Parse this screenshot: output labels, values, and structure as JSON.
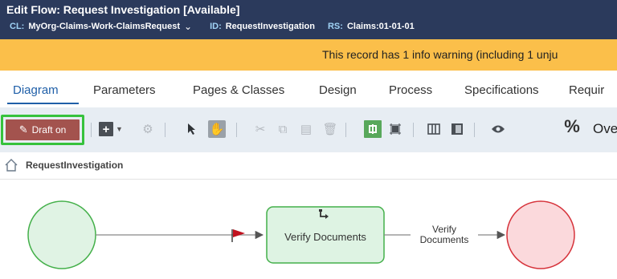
{
  "header": {
    "title": "Edit  Flow: Request Investigation [Available]",
    "cl_label": "CL:",
    "cl_value": "MyOrg-Claims-Work-ClaimsRequest",
    "id_label": "ID:",
    "id_value": "RequestInvestigation",
    "rs_label": "RS:",
    "rs_value": "Claims:01-01-01"
  },
  "warning": {
    "text": "This record has 1 info warning (including 1 unju"
  },
  "tabs": [
    {
      "label": "Diagram"
    },
    {
      "label": "Parameters"
    },
    {
      "label": "Pages & Classes"
    },
    {
      "label": "Design"
    },
    {
      "label": "Process"
    },
    {
      "label": "Specifications"
    },
    {
      "label": "Requir"
    }
  ],
  "toolbar": {
    "draft_label": "Draft on",
    "overflow_label": "Ove",
    "percent_label": "%"
  },
  "breadcrumb": {
    "label": "RequestInvestigation"
  },
  "diagram": {
    "assignment_label": "Verify Documents",
    "connector_label_line1": "Verify",
    "connector_label_line2": "Documents"
  },
  "colors": {
    "header_bg": "#2b3a5c",
    "warning_bg": "#fbbf4a",
    "draft_bg": "#a3534e",
    "draft_outline": "#36c23c",
    "start_fill": "#e0f3e4",
    "end_fill": "#fbd9dc",
    "active_tab": "#1f5fa8"
  }
}
